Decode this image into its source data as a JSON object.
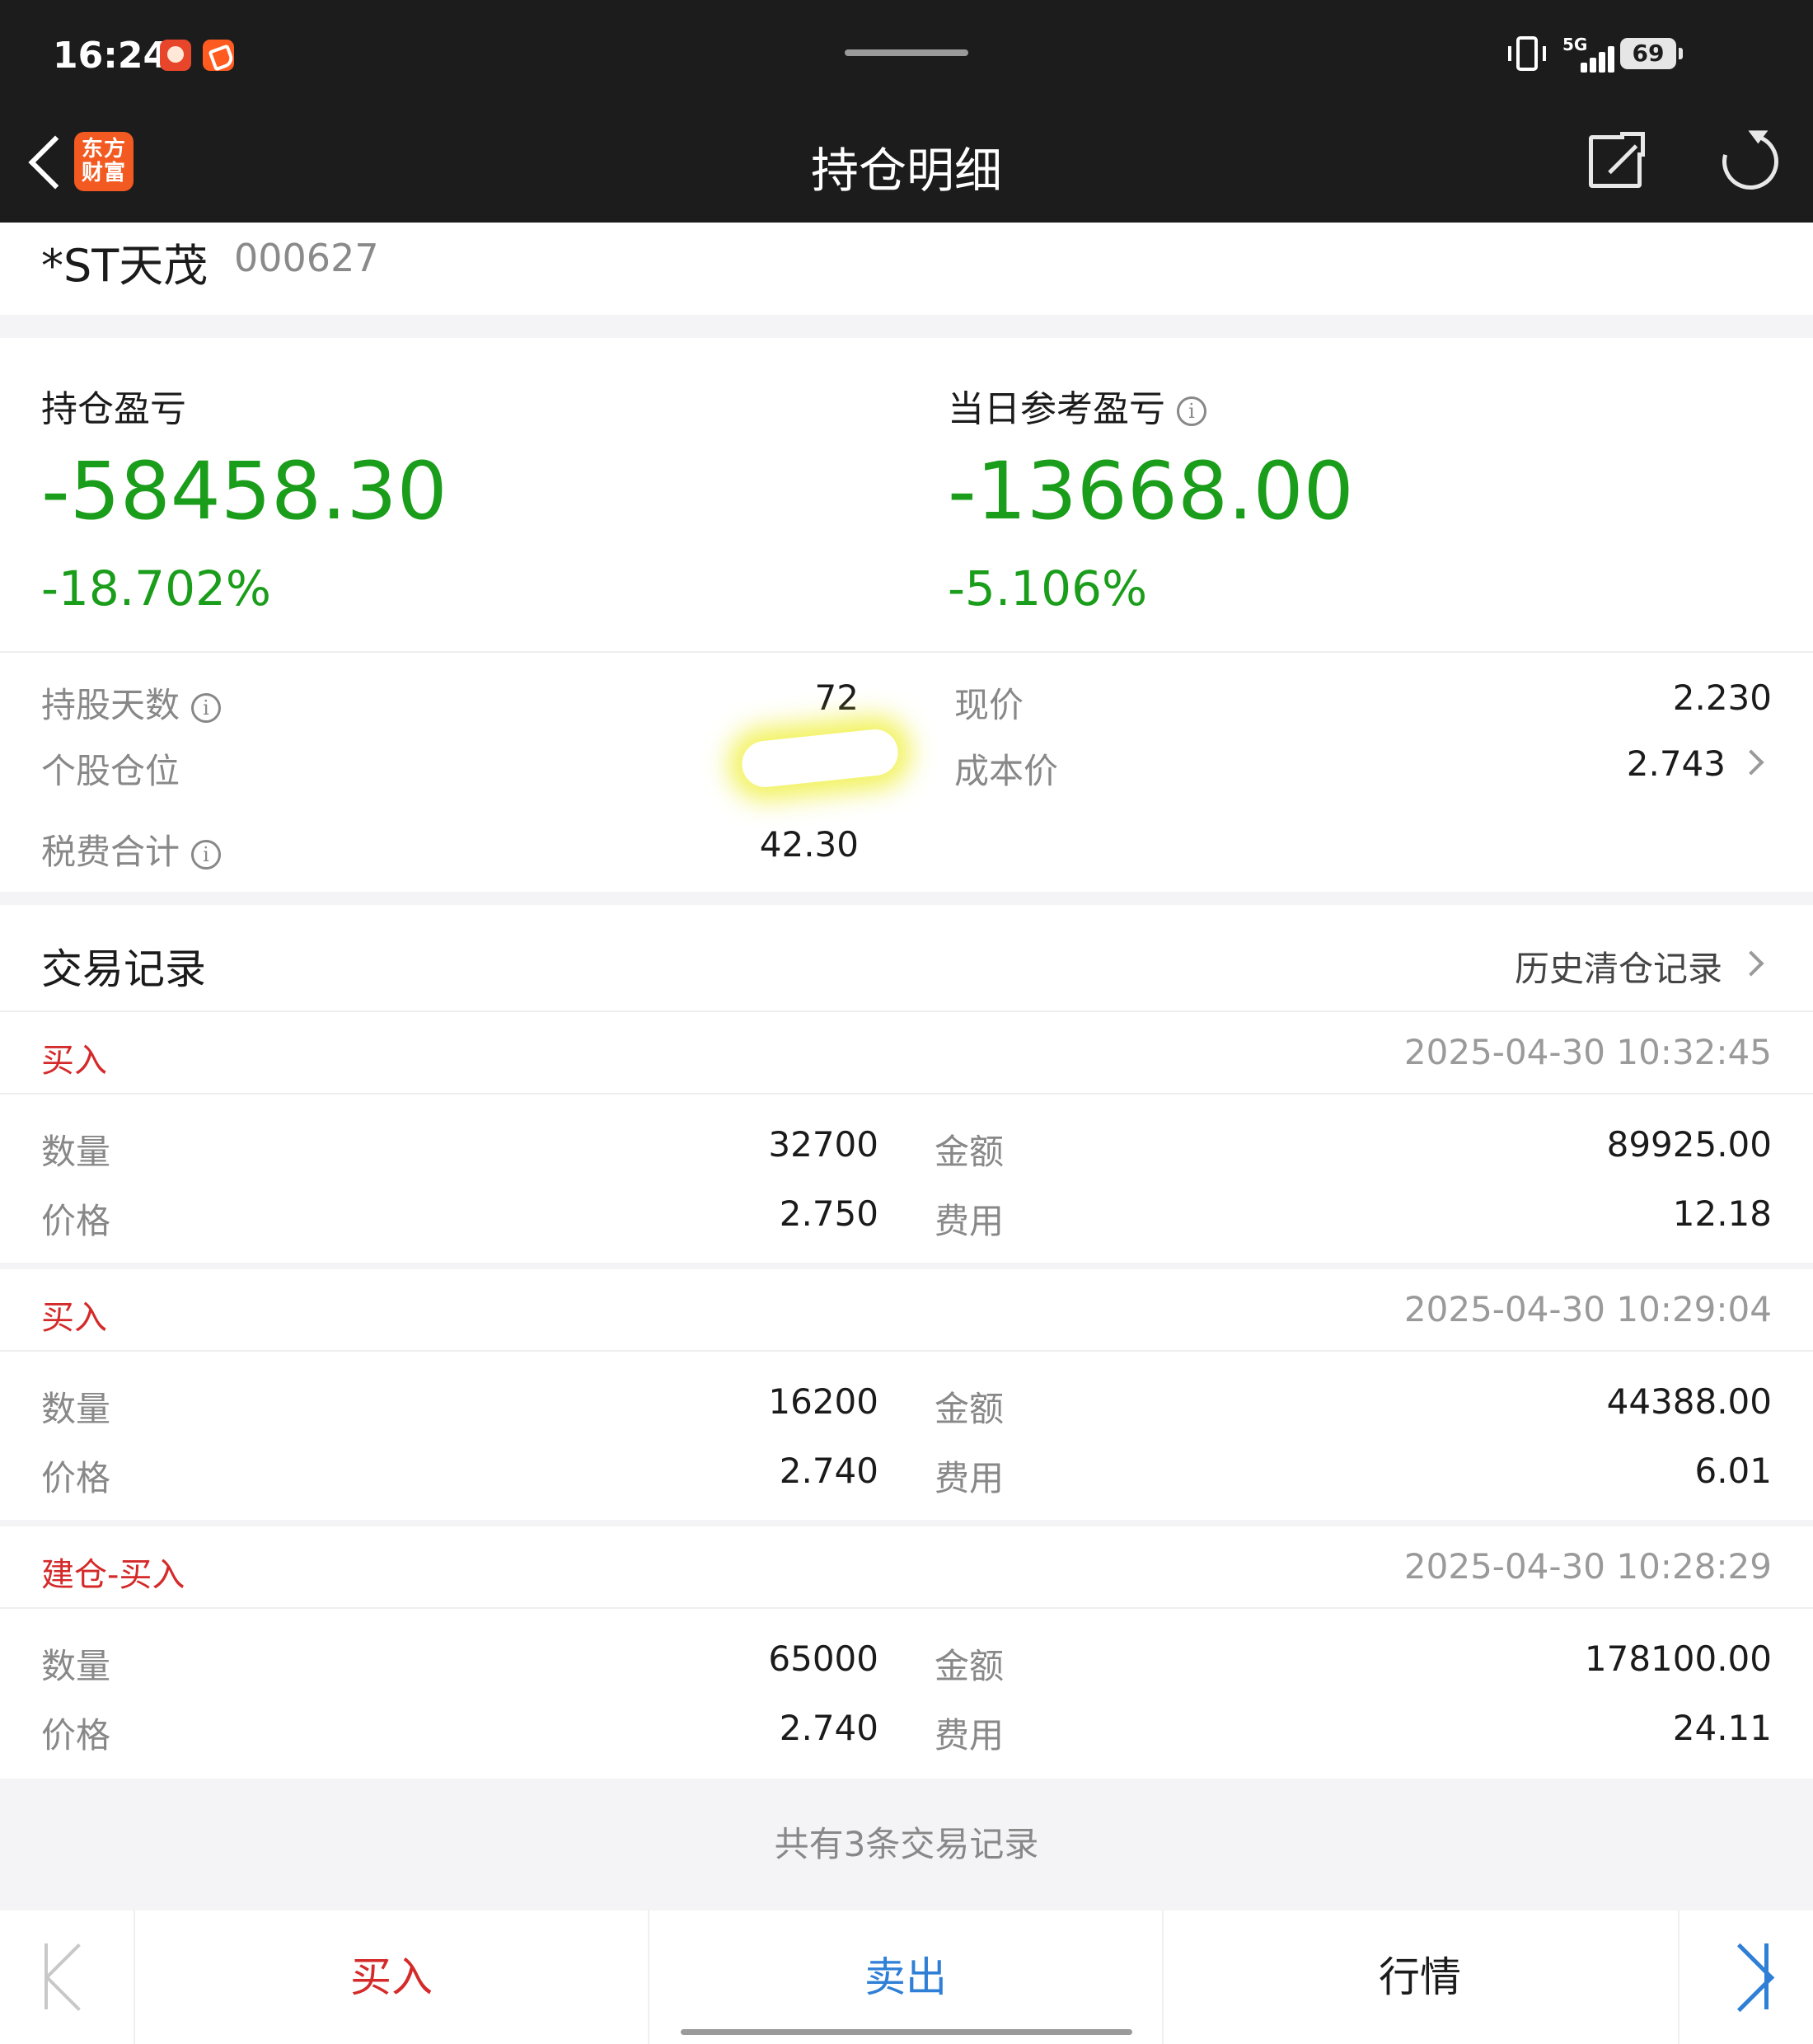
{
  "status_bar": {
    "time": "16:24",
    "network": "5G",
    "battery": "69"
  },
  "nav": {
    "title": "持仓明细",
    "logo_line1": "东方",
    "logo_line2": "财富"
  },
  "stock": {
    "name": "*ST天茂",
    "code": "000627"
  },
  "summary": {
    "position_pl_label": "持仓盈亏",
    "position_pl_value": "-58458.30",
    "position_pl_pct": "-18.702%",
    "daily_pl_label": "当日参考盈亏",
    "daily_pl_value": "-13668.00",
    "daily_pl_pct": "-5.106%"
  },
  "details": {
    "holding_days_label": "持股天数",
    "holding_days_value": "72",
    "position_ratio_label": "个股仓位",
    "tax_fee_label": "税费合计",
    "tax_fee_value": "42.30",
    "current_price_label": "现价",
    "current_price_value": "2.230",
    "cost_price_label": "成本价",
    "cost_price_value": "2.743"
  },
  "records_header": {
    "title": "交易记录",
    "history_link": "历史清仓记录"
  },
  "field_labels": {
    "quantity": "数量",
    "price": "价格",
    "amount": "金额",
    "fee": "费用"
  },
  "records": [
    {
      "type": "买入",
      "time": "2025-04-30 10:32:45",
      "quantity": "32700",
      "price": "2.750",
      "amount": "89925.00",
      "fee": "12.18"
    },
    {
      "type": "买入",
      "time": "2025-04-30 10:29:04",
      "quantity": "16200",
      "price": "2.740",
      "amount": "44388.00",
      "fee": "6.01"
    },
    {
      "type": "建仓-买入",
      "time": "2025-04-30 10:28:29",
      "quantity": "65000",
      "price": "2.740",
      "amount": "178100.00",
      "fee": "24.11"
    }
  ],
  "footer_note": "共有3条交易记录",
  "bottom_bar": {
    "buy": "买入",
    "sell": "卖出",
    "market": "行情"
  },
  "colors": {
    "loss_green": "#1a9d1a",
    "buy_red": "#d42a2a",
    "sell_blue": "#2f7fd6"
  }
}
